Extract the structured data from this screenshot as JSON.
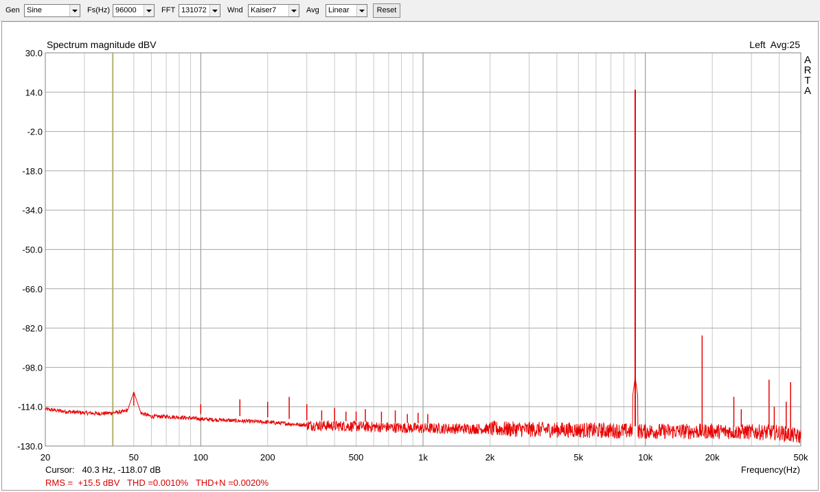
{
  "toolbar": {
    "gen_label": "Gen",
    "gen_value": "Sine",
    "fs_label": "Fs(Hz)",
    "fs_value": "96000",
    "fft_label": "FFT",
    "fft_value": "131072",
    "wnd_label": "Wnd",
    "wnd_value": "Kaiser7",
    "avg_label": "Avg",
    "avg_value": "Linear",
    "reset_label": "Reset"
  },
  "status": {
    "cursor": "Cursor:   40.3 Hz, -118.07 dB",
    "measurements": "RMS =  +15.5 dBV   THD =0.0010%   THD+N =0.0020%"
  },
  "colors": {
    "trace": "#e80000",
    "cursor_line": "#b5b54a",
    "grid": "#a0a0a0",
    "measurements_text": "#d40000"
  },
  "chart_data": {
    "type": "line",
    "title": "Spectrum magnitude dBV",
    "channel_info": "Left  Avg:25",
    "brand_letters": [
      "A",
      "R",
      "T",
      "A"
    ],
    "xlabel": "Frequency(Hz)",
    "ylabel": "",
    "x_scale": "log",
    "xlim": [
      20,
      50000
    ],
    "ylim": [
      -130,
      30
    ],
    "grid": true,
    "x_ticks": [
      20,
      50,
      100,
      200,
      500,
      1000,
      2000,
      5000,
      10000,
      20000,
      50000
    ],
    "x_tick_labels": [
      "20",
      "50",
      "100",
      "200",
      "500",
      "1k",
      "2k",
      "5k",
      "10k",
      "20k",
      "50k"
    ],
    "y_ticks": [
      30,
      14,
      -2,
      -18,
      -34,
      -50,
      -66,
      -82,
      -98,
      -114,
      -130
    ],
    "y_tick_labels": [
      "30.0",
      "14.0",
      "-2.0",
      "-18.0",
      "-34.0",
      "-50.0",
      "-66.0",
      "-82.0",
      "-98.0",
      "-114.0",
      "-130.0"
    ],
    "cursor_x": 40.3,
    "noise_floor": [
      [
        20,
        -115
      ],
      [
        25,
        -116
      ],
      [
        30,
        -116.5
      ],
      [
        35,
        -116.8
      ],
      [
        40,
        -116.5
      ],
      [
        45,
        -116
      ],
      [
        48,
        -115
      ],
      [
        60,
        -118
      ],
      [
        70,
        -118
      ],
      [
        80,
        -118.3
      ],
      [
        100,
        -119
      ],
      [
        150,
        -119.8
      ],
      [
        200,
        -120.3
      ],
      [
        300,
        -121.5
      ],
      [
        500,
        -122
      ],
      [
        1000,
        -122.8
      ],
      [
        2000,
        -123
      ],
      [
        5000,
        -123.5
      ],
      [
        10000,
        -124
      ],
      [
        20000,
        -124
      ],
      [
        40000,
        -124.5
      ],
      [
        48000,
        -126
      ]
    ],
    "peaks": [
      [
        50,
        -108
      ],
      [
        100,
        -113
      ],
      [
        150,
        -111
      ],
      [
        200,
        -112
      ],
      [
        250,
        -110
      ],
      [
        300,
        -113
      ],
      [
        350,
        -115.5
      ],
      [
        400,
        -114.5
      ],
      [
        450,
        -116
      ],
      [
        500,
        -116
      ],
      [
        550,
        -115
      ],
      [
        650,
        -116
      ],
      [
        750,
        -115.5
      ],
      [
        850,
        -117
      ],
      [
        950,
        -116.5
      ],
      [
        1050,
        -117
      ],
      [
        9000,
        15
      ],
      [
        18000,
        -85
      ],
      [
        25000,
        -110
      ],
      [
        27000,
        -115
      ],
      [
        36000,
        -103
      ],
      [
        38000,
        -114
      ],
      [
        43000,
        -112
      ],
      [
        45000,
        -104
      ]
    ]
  }
}
